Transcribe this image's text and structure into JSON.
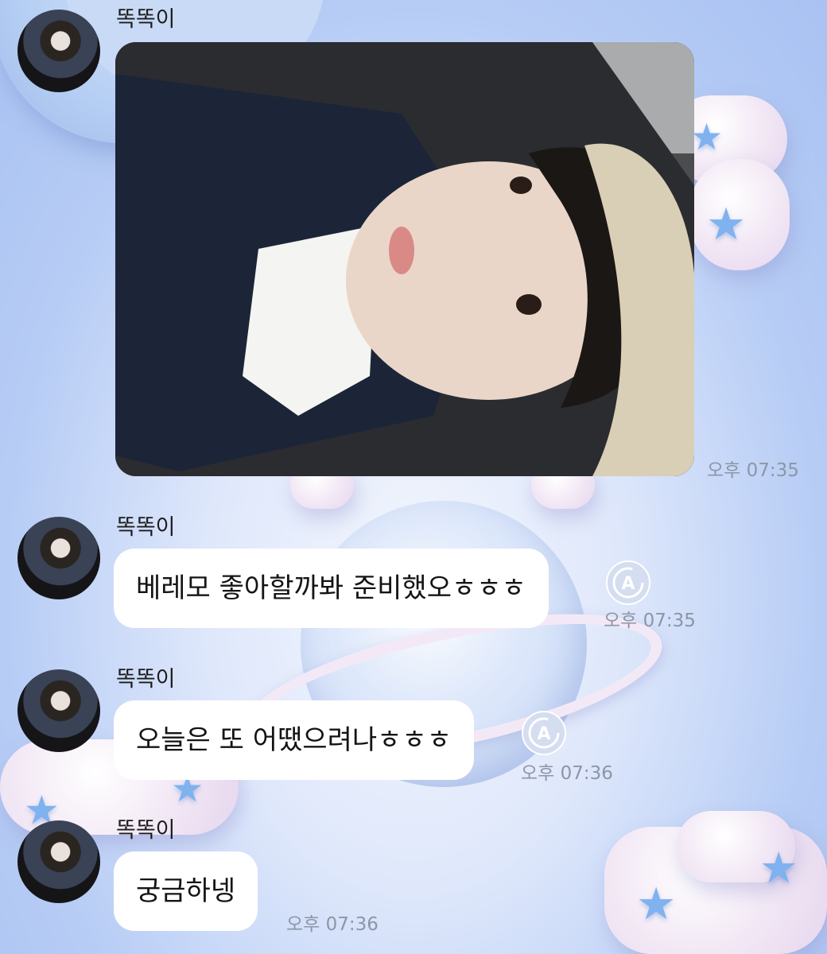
{
  "chat": {
    "messages": [
      {
        "sender": "똑똑이",
        "type": "photo",
        "time": "오후 07:35"
      },
      {
        "sender": "똑똑이",
        "type": "text",
        "text": "베레모 좋아할까봐 준비했오ㅎㅎㅎ",
        "time": "오후 07:35"
      },
      {
        "sender": "똑똑이",
        "type": "text",
        "text": "오늘은 또 어땠으려나ㅎㅎㅎ",
        "time": "오후 07:36"
      },
      {
        "sender": "똑똑이",
        "type": "text",
        "text": "궁금하넹",
        "time": "오후 07:36"
      }
    ]
  },
  "icons": {
    "translate": "translate-icon",
    "star": "star-icon"
  },
  "colors": {
    "background": "#b6ccf5",
    "bubble": "#ffffff",
    "time": "#8e95a6"
  }
}
